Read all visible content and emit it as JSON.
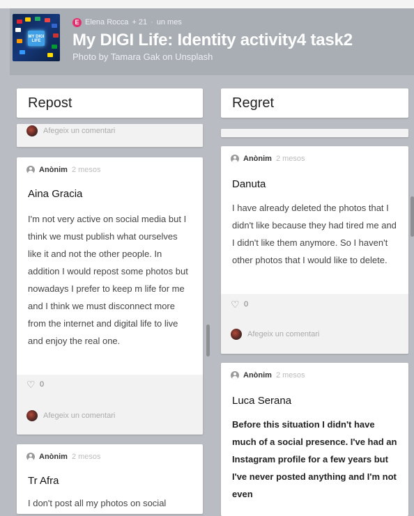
{
  "header": {
    "author_initial": "E",
    "author": "Elena Rocca",
    "followers": "+ 21",
    "time": "un mes",
    "title": "My DIGI Life: Identity activity4 task2",
    "subtitle": "Photo by Tamara Gak on Unsplash",
    "thumb_text": "MY DIGI LIFE"
  },
  "columns": [
    {
      "title": "Repost",
      "partial_card": {
        "comment_placeholder": "Afegeix un comentari"
      },
      "cards": [
        {
          "author": "Anònim",
          "time": "2 mesos",
          "title": "Aina Gracia",
          "body": "I'm not very active on social media but I think we must publish what ourselves like it and not the other people. In addition I would repost some photos but nowadays I prefer to keep m life for me and I think we must disconnect more from the internet and digital life to live and enjoy the real one.",
          "likes": "0",
          "comment_placeholder": "Afegeix un comentari"
        },
        {
          "author": "Anònim",
          "time": "2 mesos",
          "title": "Tr Afra",
          "body": "I don't post all my photos on social"
        }
      ]
    },
    {
      "title": "Regret",
      "cards": [
        {
          "author": "Anònim",
          "time": "2 mesos",
          "title": "Danuta",
          "body": "I have already deleted the photos that I didn't like because they had tired me  and I didn't like them anymore.  So I haven't  other photos that I would like to delete.",
          "likes": "0",
          "comment_placeholder": "Afegeix un comentari"
        },
        {
          "author": "Anònim",
          "time": "2 mesos",
          "title": "Luca Serana",
          "body": "Before this situation I didn't have much of a social presence.  I've had an Instagram profile for a few years but I've never posted anything and I'm not even"
        }
      ]
    }
  ]
}
